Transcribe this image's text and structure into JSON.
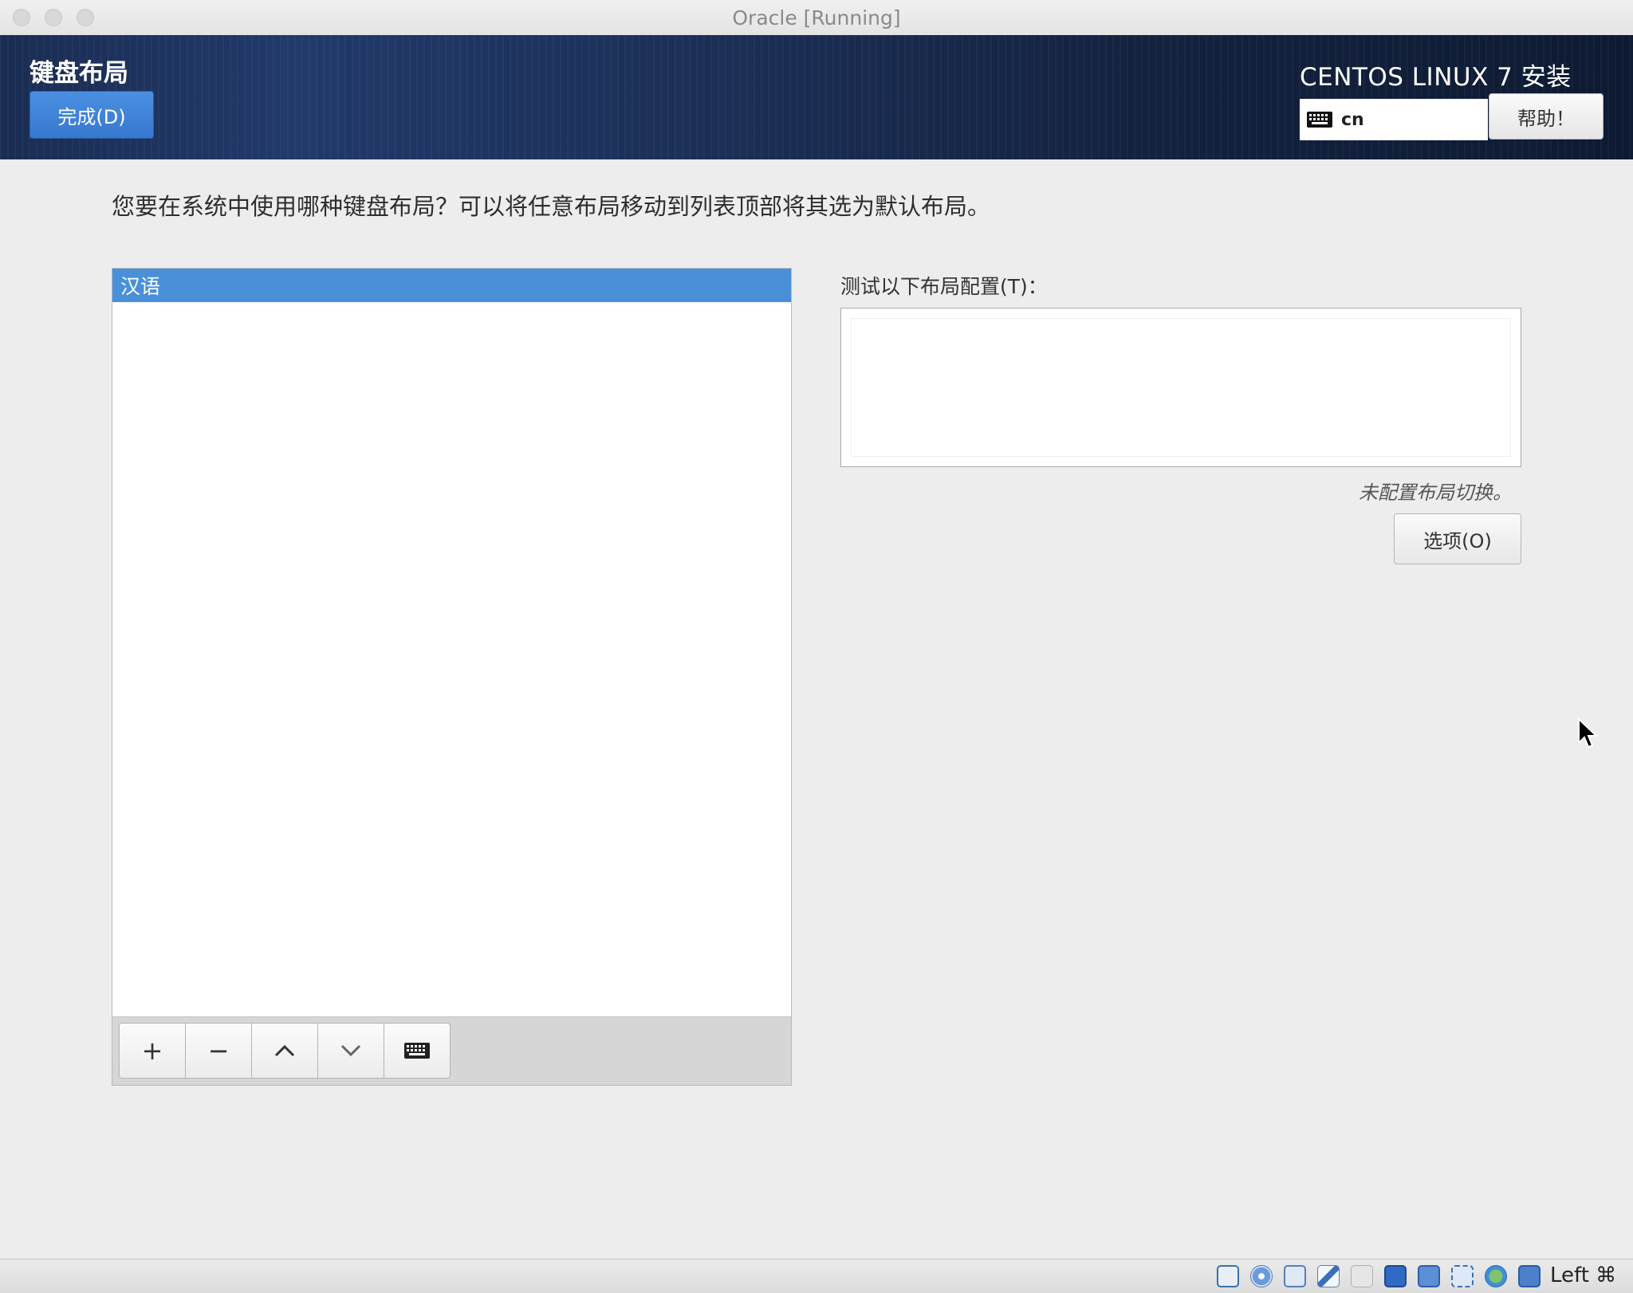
{
  "window": {
    "title": "Oracle [Running]"
  },
  "header": {
    "spoke_title": "键盘布局",
    "done_button": "完成(D)",
    "product_title": "CENTOS LINUX 7 安装",
    "keyboard_indicator": "cn",
    "help_button": "帮助！"
  },
  "main": {
    "question": "您要在系统中使用哪种键盘布局？可以将任意布局移动到列表顶部将其选为默认布局。",
    "layouts": [
      {
        "label": "汉语",
        "selected": true
      }
    ],
    "toolbar": {
      "add": "+",
      "remove": "−",
      "move_up": "move-up",
      "move_down": "move-down",
      "preview": "keyboard-preview"
    },
    "test_label": "测试以下布局配置(T)：",
    "test_value": "",
    "switch_note": "未配置布局切换。",
    "options_button": "选项(O)"
  },
  "statusbar": {
    "host_key": "Left ⌘",
    "icons": [
      "hard-disk-icon",
      "optical-drive-icon",
      "audio-icon",
      "usb-icon",
      "shared-folder-icon",
      "display-icon",
      "screen-capture-icon",
      "cpu-icon",
      "network-icon",
      "download-icon"
    ]
  },
  "colors": {
    "accent": "#4a90d9",
    "header_dark": "#14223f",
    "background": "#ededed"
  }
}
